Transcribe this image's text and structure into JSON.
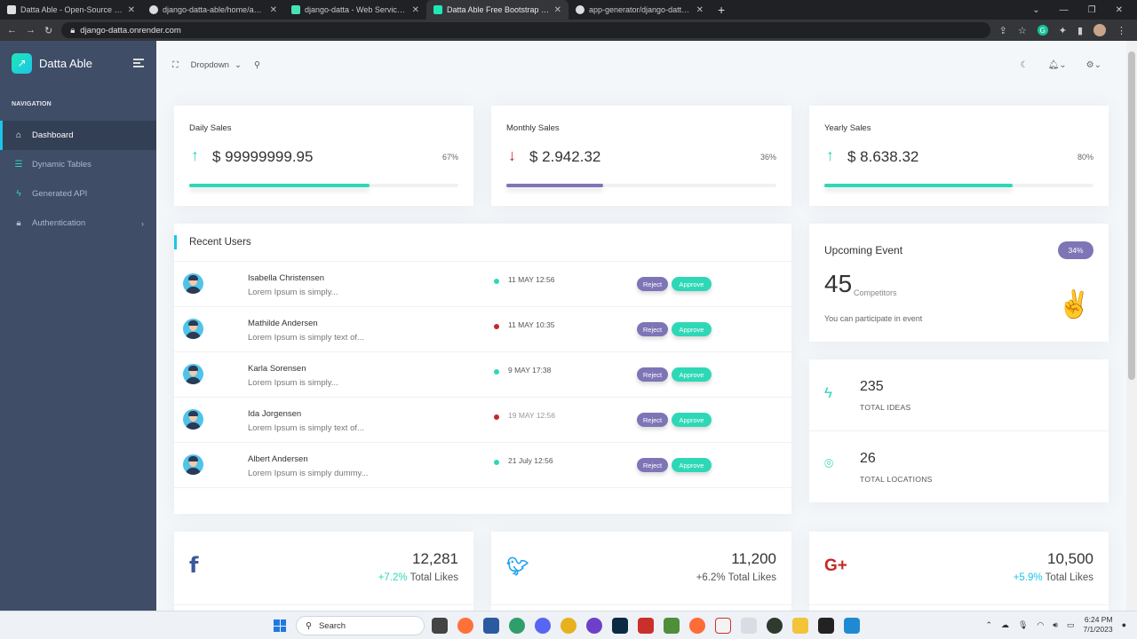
{
  "browser": {
    "tabs": [
      {
        "title": "Datta Able - Open-Source Djang",
        "active": false,
        "icon_color": "#e0e0e0"
      },
      {
        "title": "django-datta-able/home/admin.",
        "active": false,
        "icon_color": "#202124"
      },
      {
        "title": "django-datta - Web Service - Re",
        "active": false,
        "icon_color": "#46e3b7"
      },
      {
        "title": "Datta Able Free Bootstrap 4 Adm",
        "active": true,
        "icon_color": "#1de9b6"
      },
      {
        "title": "app-generator/django-datta-abl",
        "active": false,
        "icon_color": "#202124"
      }
    ],
    "url": "django-datta.onrender.com"
  },
  "sidebar": {
    "brand": "Datta Able",
    "caption": "NAVIGATION",
    "items": [
      {
        "label": "Dashboard",
        "icon": "home-icon",
        "active": true
      },
      {
        "label": "Dynamic Tables",
        "icon": "server-icon",
        "active": false
      },
      {
        "label": "Generated API",
        "icon": "zap-icon",
        "active": false
      },
      {
        "label": "Authentication",
        "icon": "lock-icon",
        "active": false,
        "has_submenu": true
      }
    ]
  },
  "header": {
    "dropdown_label": "Dropdown"
  },
  "sales": [
    {
      "title": "Daily Sales",
      "value": "$ 99999999.95",
      "percent_label": "67%",
      "percent": 67,
      "trend": "up",
      "color": "#2ed8b6"
    },
    {
      "title": "Monthly Sales",
      "value": "$ 2.942.32",
      "percent_label": "36%",
      "percent": 36,
      "trend": "down",
      "color": "#7e75b6"
    },
    {
      "title": "Yearly Sales",
      "value": "$ 8.638.32",
      "percent_label": "80%",
      "percent": 70,
      "trend": "up",
      "color": "#2ed8b6"
    }
  ],
  "recent_users": {
    "title": "Recent Users",
    "reject_label": "Reject",
    "approve_label": "Approve",
    "rows": [
      {
        "name": "Isabella Christensen",
        "desc": "Lorem Ipsum is simply...",
        "date": "11 MAY 12:56",
        "status": "green"
      },
      {
        "name": "Mathilde Andersen",
        "desc": "Lorem Ipsum is simply text of...",
        "date": "11 MAY 10:35",
        "status": "red"
      },
      {
        "name": "Karla Sorensen",
        "desc": "Lorem Ipsum is simply...",
        "date": "9 MAY 17:38",
        "status": "green"
      },
      {
        "name": "Ida Jorgensen",
        "desc": "Lorem Ipsum is simply text of...",
        "date": "19 MAY 12:56",
        "status": "red"
      },
      {
        "name": "Albert Andersen",
        "desc": "Lorem Ipsum is simply dummy...",
        "date": "21 July 12:56",
        "status": "green"
      }
    ]
  },
  "event": {
    "title": "Upcoming Event",
    "badge": "34%",
    "number": "45",
    "number_label": "Competitors",
    "desc": "You can participate in event"
  },
  "stats": [
    {
      "value": "235",
      "label": "TOTAL IDEAS",
      "icon": "zap-icon"
    },
    {
      "value": "26",
      "label": "TOTAL LOCATIONS",
      "icon": "map-pin-icon"
    }
  ],
  "social": [
    {
      "network": "facebook",
      "icon_text": "f",
      "icon_color": "#3b5998",
      "value": "12,281",
      "change": "+7.2%",
      "change_color": "#2ed8b6",
      "suffix": "Total Likes"
    },
    {
      "network": "twitter",
      "icon_text": "🐦",
      "icon_color": "#1da1f2",
      "value": "11,200",
      "change": "+6.2%",
      "change_color": "#555555",
      "suffix": "Total Likes"
    },
    {
      "network": "google-plus",
      "icon_text": "G+",
      "icon_color": "#dd4b39",
      "value": "10,500",
      "change": "+5.9%",
      "change_color": "#1dc4e9",
      "suffix": "Total Likes"
    }
  ],
  "taskbar": {
    "search_label": "Search",
    "time": "6:24 PM",
    "date": "7/1/2023"
  },
  "colors": {
    "sidebar_bg": "#3f4d67",
    "accent_teal": "#2ed8b6",
    "accent_purple": "#7e75b6",
    "accent_blue": "#1dc4e9",
    "status_red": "#c62828"
  }
}
